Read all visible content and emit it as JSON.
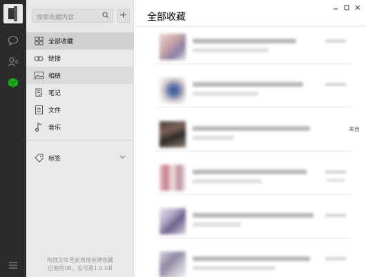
{
  "sidebar_icons": [
    "avatar",
    "chat-icon",
    "contacts-icon",
    "favorites-cube-icon",
    "menu-icon"
  ],
  "search": {
    "placeholder": "搜索收藏内容"
  },
  "add_button": "+",
  "nav": [
    {
      "label": "全部收藏",
      "icon": "grid-icon",
      "state": "active"
    },
    {
      "label": "链接",
      "icon": "link-icon",
      "state": "normal"
    },
    {
      "label": "相册",
      "icon": "image-icon",
      "state": "hover"
    },
    {
      "label": "笔记",
      "icon": "note-icon",
      "state": "normal"
    },
    {
      "label": "文件",
      "icon": "file-icon",
      "state": "normal"
    },
    {
      "label": "音乐",
      "icon": "music-icon",
      "state": "normal"
    }
  ],
  "tags_label": "标签",
  "footer": {
    "line1": "拖拽文件至此直接新建收藏",
    "line2": "已使用0B，总可用1.0 GB"
  },
  "main": {
    "title": "全部收藏",
    "side_note": "来自"
  },
  "colors": {
    "rail": "#2b2b2b",
    "panel": "#ebe9e8",
    "accent_green": "#1aad19"
  }
}
